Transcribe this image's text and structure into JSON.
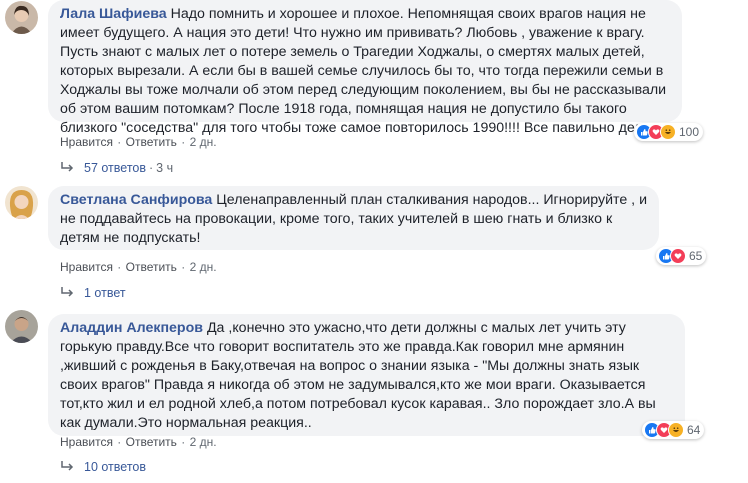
{
  "comments": [
    {
      "author": "Лала Шафиева",
      "text": "Надо помнить и хорошее и плохое. Непомнящая своих врагов нация не имеет будущего. А нация это дети! Что нужно им прививать? Любовь , уважение к врагу. Пусть знают с малых лет о потере земель о Трагедии Ходжалы, о смертях малых детей, которых вырезали. А если бы в вашей семье случилось бы то, что тогда пережили семьи в Ходжалы вы тоже молчали об этом перед следующим поколением, вы бы не рассказывали об этом вашим потомкам? После 1918 года, помнящая нация не допустило бы такого близкого \"соседства\" для того чтобы тоже самое повторилось 1990!!!! Все павильно делает",
      "like": "Нравится",
      "reply": "Ответить",
      "time": "2 дн.",
      "reaction_count": "100",
      "replies_label": "57 ответов",
      "replies_time": "3 ч"
    },
    {
      "author": "Светлана Санфирова",
      "text": "Целенаправленный план сталкивания народов... Игнорируйте , и не поддавайтесь на провокации, кроме того, таких учителей в шею гнать и близко к детям не подпускать!",
      "like": "Нравится",
      "reply": "Ответить",
      "time": "2 дн.",
      "reaction_count": "65",
      "replies_label": "1 ответ",
      "replies_time": ""
    },
    {
      "author": "Аладдин Алекперов",
      "text": "Да ,конечно это ужасно,что дети должны с малых лет учить эту горькую правду.Все что говорит воспитатель это же правда.Как говорил мне армянин ,живший с рожденья в Баку,отвечая на вопрос о знании языка - \"Мы должны знать язык своих врагов\" Правда я никогда об этом не задумывался,кто же мои враги. Оказывается тот,кто жил и ел родной хлеб,а потом потребовал кусок каравая.. Зло порождает зло.А вы как думали.Это нормальная реакция..",
      "like": "Нравится",
      "reply": "Ответить",
      "time": "2 дн.",
      "reaction_count": "64",
      "replies_label": "10 ответов",
      "replies_time": ""
    }
  ],
  "separator": "·",
  "colors": {
    "author": "#385898",
    "bubble": "#f2f3f5",
    "like": "#1877f2",
    "love": "#f33e58",
    "haha": "#f7b125"
  }
}
